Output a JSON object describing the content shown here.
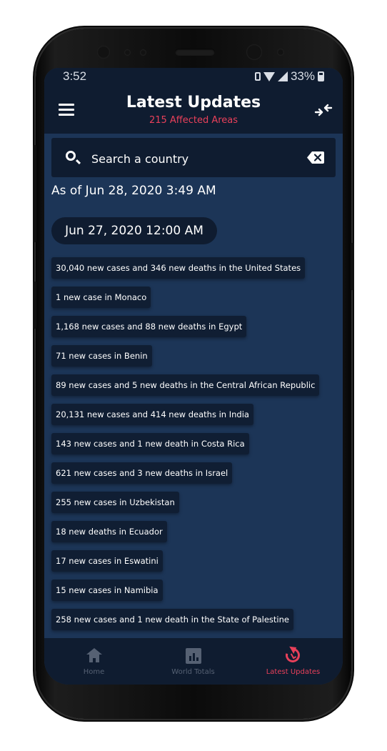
{
  "status_bar": {
    "time": "3:52",
    "battery": "33%"
  },
  "header": {
    "title": "Latest Updates",
    "subtitle": "215 Affected Areas",
    "menu_icon": "menu-icon",
    "compress_icon": "compress-arrows-icon"
  },
  "search": {
    "placeholder": "Search a country",
    "value": "",
    "clear_icon": "backspace-clear-icon"
  },
  "as_of": "As of Jun 28, 2020 3:49 AM",
  "date_group": "Jun 27, 2020 12:00 AM",
  "updates": [
    "30,040 new cases and 346 new deaths in the United States",
    "1 new case in Monaco",
    "1,168 new cases and 88 new deaths in Egypt",
    "71 new cases in Benin",
    "89 new cases and 5 new deaths in the Central African Republic",
    "20,131 new cases and 414 new deaths in India",
    "143 new cases and 1 new death in Costa Rica",
    "621 new cases and 3 new deaths in Israel",
    "255 new cases in Uzbekistan",
    "18 new deaths in Ecuador",
    "17 new cases in Eswatini",
    "15 new cases in Namibia",
    "258 new cases and 1 new death in the State of Palestine"
  ],
  "bottom_nav": [
    {
      "label": "Home",
      "icon": "home-icon",
      "active": false
    },
    {
      "label": "World Totals",
      "icon": "bar-chart-icon",
      "active": false
    },
    {
      "label": "Latest Updates",
      "icon": "refresh-clock-icon",
      "active": true
    }
  ],
  "colors": {
    "background": "#1c3557",
    "bar": "#0f1c30",
    "accent": "#e8405a",
    "inactive": "#566173"
  }
}
